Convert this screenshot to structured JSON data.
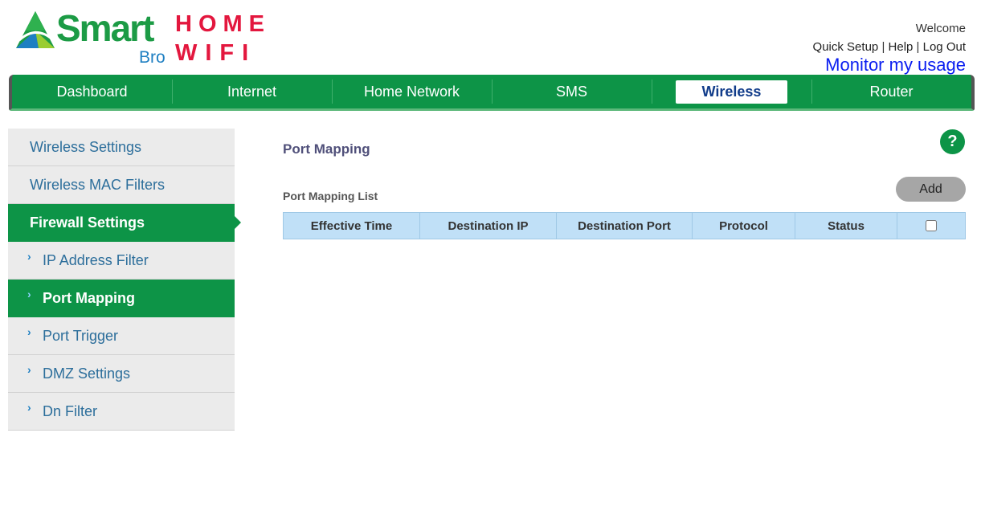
{
  "brand": {
    "name": "Smart",
    "sub": "Bro",
    "product_line1": "HOME",
    "product_line2": "WIFI"
  },
  "header": {
    "welcome": "Welcome",
    "quick_setup": "Quick Setup",
    "separator": "|",
    "help": "Help",
    "logout": "Log Out",
    "monitor": "Monitor my usage"
  },
  "nav": {
    "items": [
      {
        "label": "Dashboard"
      },
      {
        "label": "Internet"
      },
      {
        "label": "Home Network"
      },
      {
        "label": "SMS"
      },
      {
        "label": "Wireless"
      },
      {
        "label": "Router"
      }
    ],
    "active": "Wireless"
  },
  "sidebar": {
    "items": [
      {
        "label": "Wireless Settings"
      },
      {
        "label": "Wireless MAC Filters"
      },
      {
        "label": "Firewall Settings"
      },
      {
        "label": "IP Address Filter"
      },
      {
        "label": "Port Mapping"
      },
      {
        "label": "Port Trigger"
      },
      {
        "label": "DMZ Settings"
      },
      {
        "label": "Dn Filter"
      }
    ],
    "chevron": "›"
  },
  "main": {
    "title": "Port Mapping",
    "help_icon": "?",
    "list_title": "Port Mapping List",
    "add_label": "Add",
    "table": {
      "columns": [
        "Effective Time",
        "Destination IP",
        "Destination Port",
        "Protocol",
        "Status"
      ],
      "select_all_checked": false,
      "rows": []
    }
  },
  "colors": {
    "brand_green": "#0d9447",
    "brand_red": "#e3173e",
    "link_blue": "#0a1ef0",
    "table_header": "#c0e0f7"
  }
}
